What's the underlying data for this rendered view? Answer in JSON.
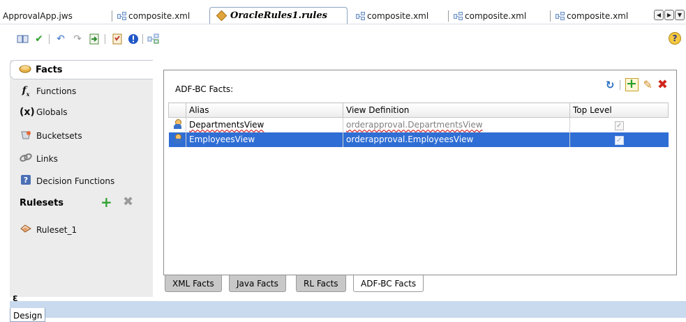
{
  "editor_tabs": {
    "t1": "ApprovalApp.jws",
    "t2": "composite.xml",
    "active": "OracleRules1.rules",
    "t4": "composite.xml",
    "t5": "composite.xml",
    "t6": "composite.xml"
  },
  "nav": {
    "selected": "Facts",
    "items": [
      "Functions",
      "Globals",
      "Bucketsets",
      "Links",
      "Decision Functions"
    ],
    "rulesets_header": "Rulesets",
    "ruleset_item": "Ruleset_1",
    "collapse_glyph": "Ɛ"
  },
  "panel": {
    "header": "ADF-BC Facts:",
    "columns": [
      "Alias",
      "View Definition",
      "Top Level"
    ],
    "rows": [
      {
        "alias": "DepartmentsView",
        "view_def": "orderapproval.DepartmentsView",
        "top_level": true
      },
      {
        "alias": "EmployeesView",
        "view_def": "orderapproval.EmployeesView",
        "top_level": true
      }
    ],
    "selected_row": 1
  },
  "fact_tabs": {
    "xml": "XML Facts",
    "java": "Java Facts",
    "rl": "RL Facts",
    "adfbc": "ADF-BC Facts",
    "active": "ADF-BC Facts"
  },
  "bottom": {
    "design_tab": "Design"
  },
  "colors": {
    "selection": "#2f6ed4",
    "accent_green": "#2fa22f",
    "delete_red": "#d0271d"
  }
}
